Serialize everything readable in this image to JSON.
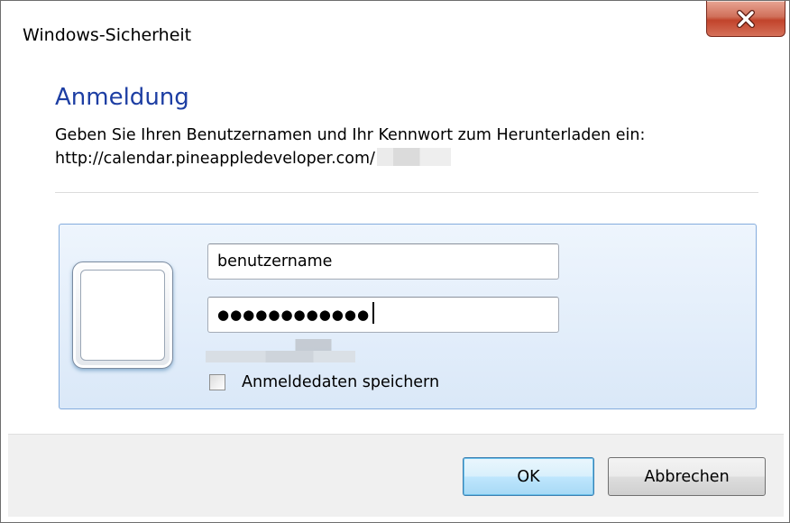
{
  "window": {
    "title": "Windows-Sicherheit",
    "close_icon": "close-x-icon"
  },
  "content": {
    "heading": "Anmeldung",
    "description": "Geben Sie Ihren Benutzernamen und Ihr Kennwort zum Herunterladen ein:",
    "url": "http://calendar.pineappledeveloper.com/"
  },
  "credentials": {
    "user_tile_icon": "user-tile-icon",
    "username_value": "benutzername",
    "password_mask": "●●●●●●●●●●●●",
    "remember_label": "Anmeldedaten speichern",
    "remember_checked": false
  },
  "buttons": {
    "ok_label": "OK",
    "cancel_label": "Abbrechen"
  },
  "colors": {
    "heading": "#1d3ea3",
    "panel_border": "#84acdd",
    "close_button": "#c1432b",
    "ok_button_border": "#3c7fb1"
  }
}
